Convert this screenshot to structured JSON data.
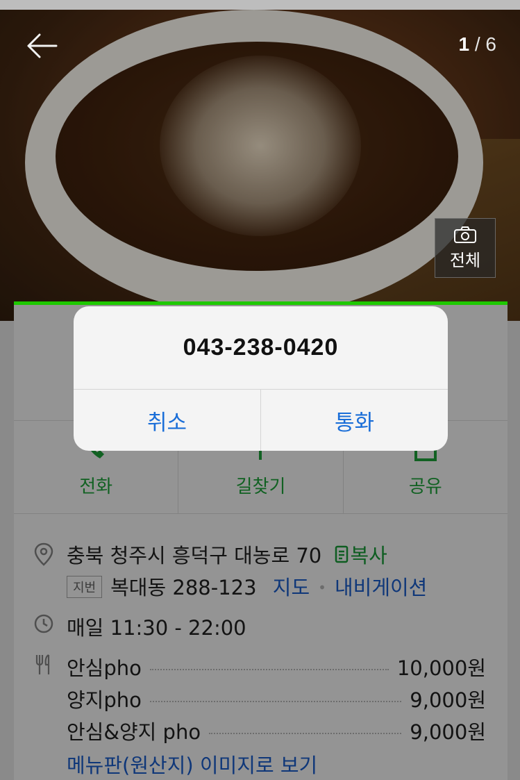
{
  "photo": {
    "counter_current": "1",
    "counter_total": "/ 6",
    "all_label": "전체"
  },
  "actions": [
    {
      "label": "전화",
      "icon": "phone-icon"
    },
    {
      "label": "길찾기",
      "icon": "directions-icon"
    },
    {
      "label": "공유",
      "icon": "share-icon"
    }
  ],
  "info": {
    "address": "충북 청주시 흥덕구 대농로 70",
    "copy_label": "복사",
    "jibeon_badge": "지번",
    "jibeon_address": "복대동 288-123",
    "map_link": "지도",
    "navigation_link": "내비게이션",
    "hours": "매일 11:30 - 22:00",
    "menu": [
      {
        "name": "안심pho",
        "price": "10,000원"
      },
      {
        "name": "양지pho",
        "price": "9,000원"
      },
      {
        "name": "안심&양지 pho",
        "price": "9,000원"
      }
    ],
    "menu_image_link": "메뉴판(원산지) 이미지로 보기"
  },
  "dialog": {
    "phone_number": "043-238-0420",
    "cancel_label": "취소",
    "call_label": "통화"
  },
  "colors": {
    "accent_green": "#1ec800",
    "link_blue": "#1a5fd1",
    "dialog_button_blue": "#1a6ed8"
  }
}
